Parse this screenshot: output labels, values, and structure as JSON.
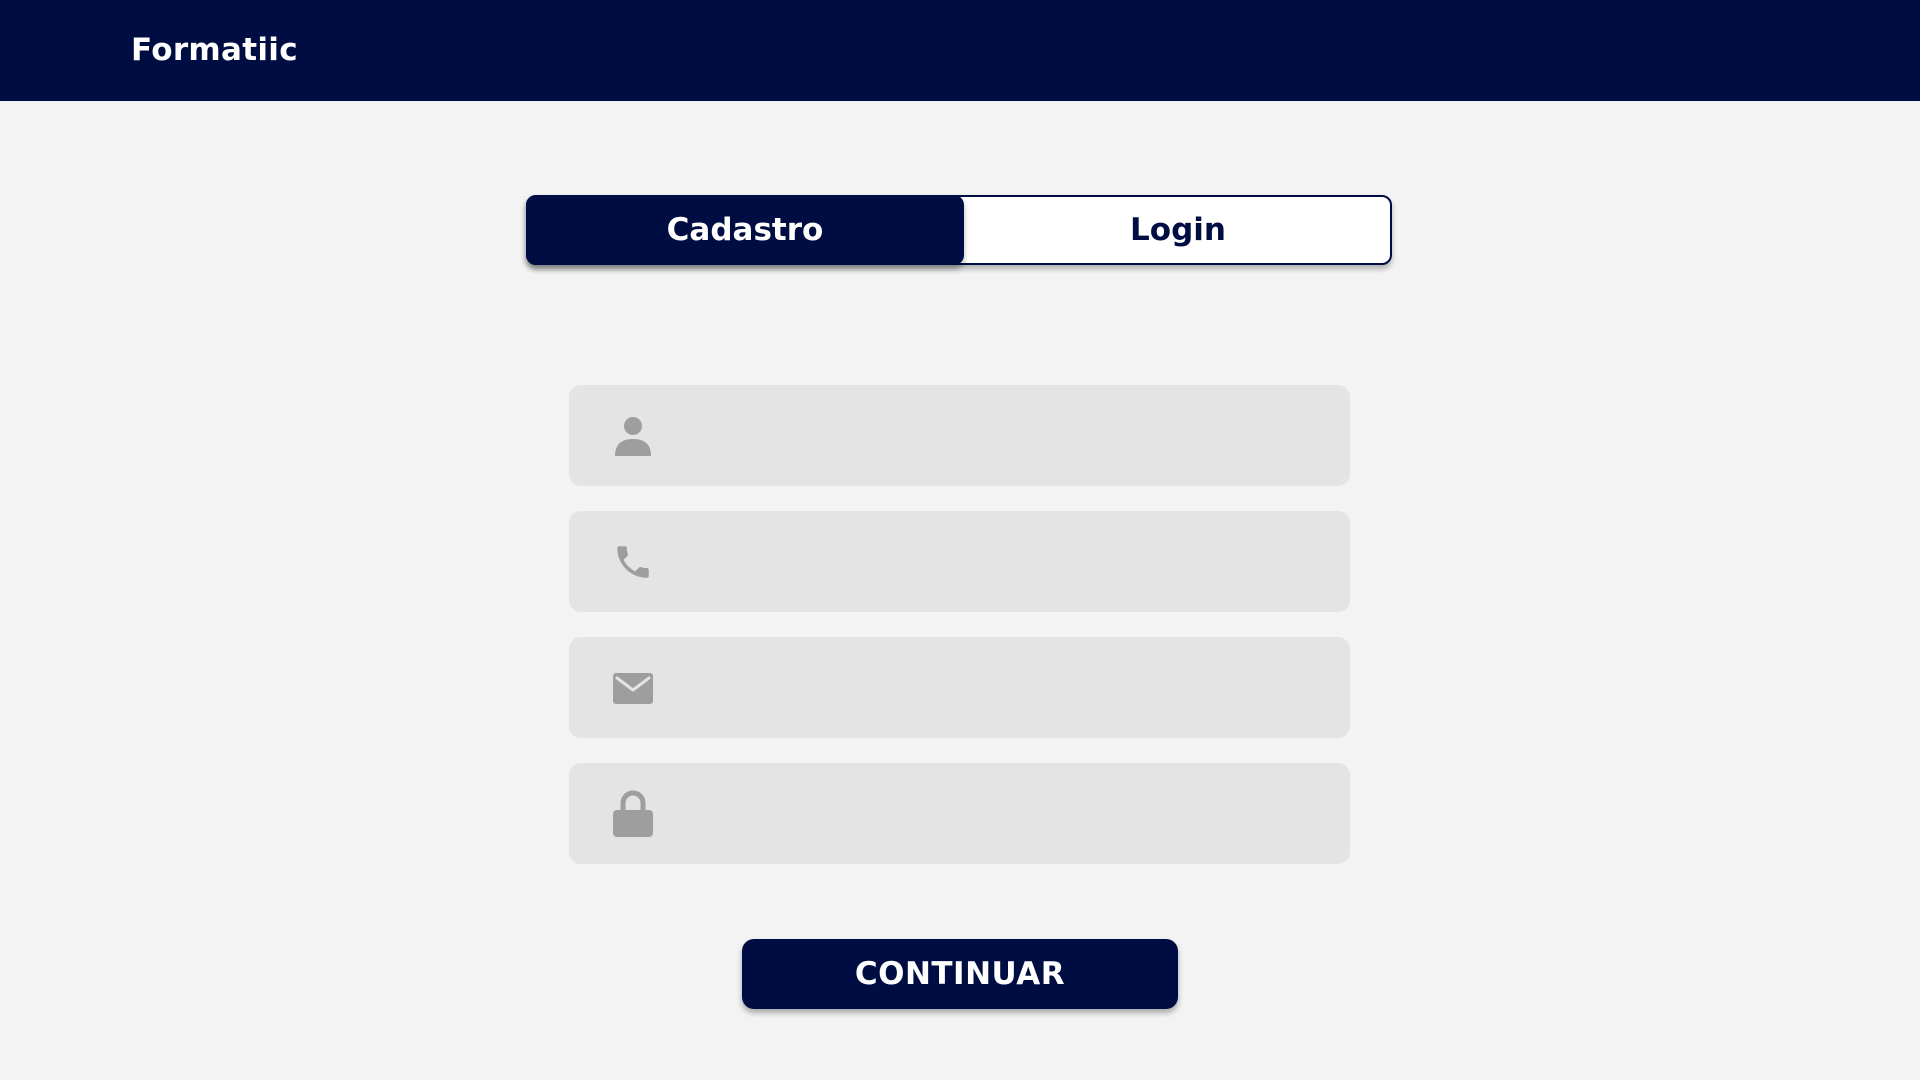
{
  "app": {
    "title": "Formatiic"
  },
  "auth_tabs": [
    {
      "label": "Cadastro",
      "active": true
    },
    {
      "label": "Login",
      "active": false
    }
  ],
  "form": {
    "fields": [
      {
        "name": "name",
        "icon": "person-icon",
        "value": "",
        "placeholder": ""
      },
      {
        "name": "phone",
        "icon": "phone-icon",
        "value": "",
        "placeholder": ""
      },
      {
        "name": "email",
        "icon": "envelope-icon",
        "value": "",
        "placeholder": ""
      },
      {
        "name": "password",
        "icon": "lock-icon",
        "value": "",
        "placeholder": ""
      }
    ],
    "submit_label": "CONTINUAR"
  },
  "colors": {
    "brand": "#000d42",
    "background": "#f3f3f3",
    "field_background": "#e4e4e4",
    "icon": "#9e9e9e"
  }
}
